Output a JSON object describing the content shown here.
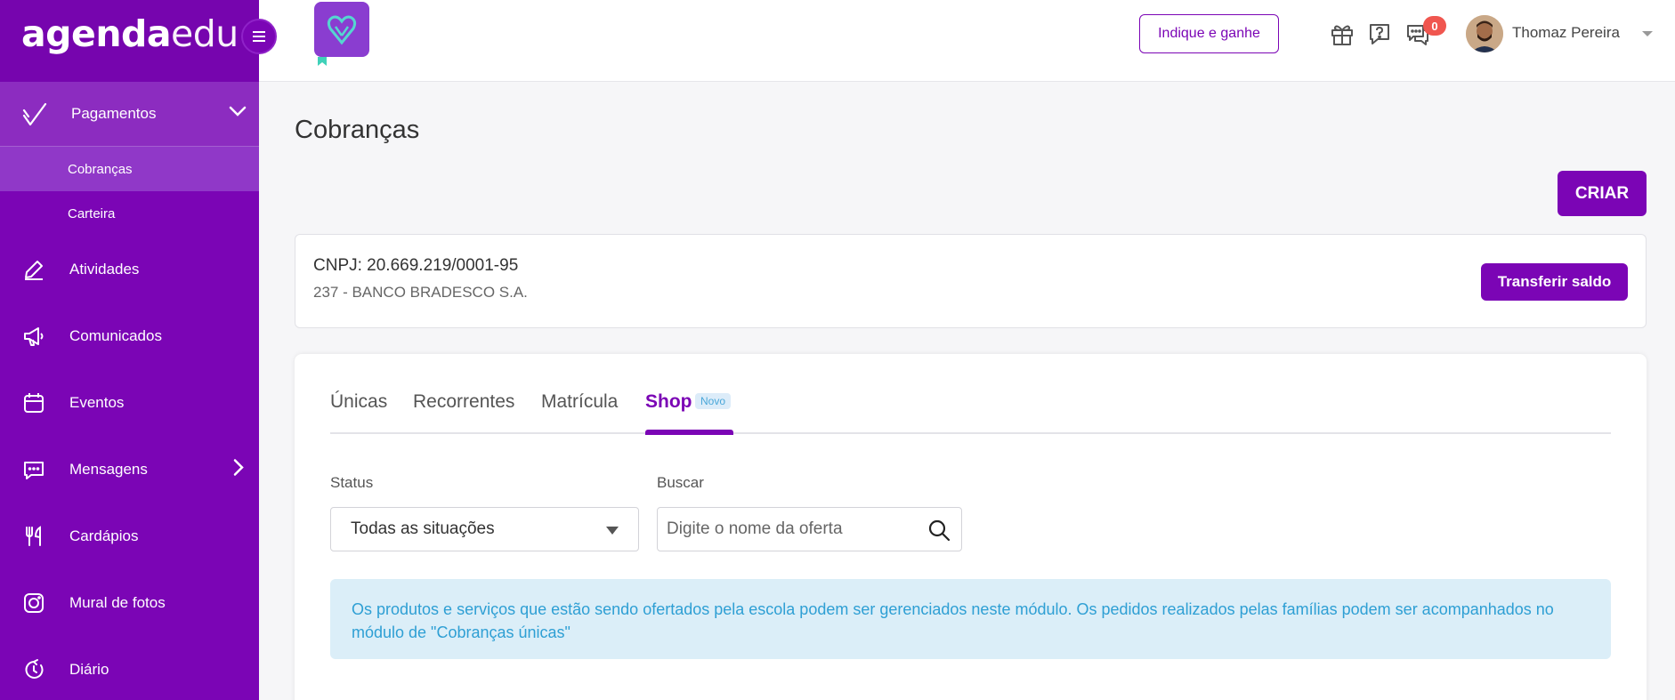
{
  "brand": {
    "part1": "agenda",
    "part2": "edu"
  },
  "sidebar": {
    "parent": {
      "label": "Pagamentos"
    },
    "sub_items": [
      {
        "label": "Cobranças"
      },
      {
        "label": "Carteira"
      }
    ],
    "items": [
      {
        "label": "Atividades",
        "icon": "pencil-icon"
      },
      {
        "label": "Comunicados",
        "icon": "megaphone-icon"
      },
      {
        "label": "Eventos",
        "icon": "calendar-icon"
      },
      {
        "label": "Mensagens",
        "icon": "chat-icon"
      },
      {
        "label": "Cardápios",
        "icon": "utensils-icon"
      },
      {
        "label": "Mural de fotos",
        "icon": "camera-icon"
      },
      {
        "label": "Diário",
        "icon": "clock-icon"
      }
    ]
  },
  "topbar": {
    "indique_label": "Indique e ganhe",
    "notifications_count": "0",
    "user_name": "Thomaz Pereira"
  },
  "page": {
    "title": "Cobranças",
    "criar_label": "CRIAR"
  },
  "account": {
    "cnpj": "CNPJ: 20.669.219/0001-95",
    "bank": "237 - BANCO BRADESCO S.A.",
    "transfer_label": "Transferir saldo"
  },
  "tabs": [
    {
      "label": "Únicas"
    },
    {
      "label": "Recorrentes"
    },
    {
      "label": "Matrícula"
    },
    {
      "label": "Shop",
      "badge": "Novo"
    }
  ],
  "filters": {
    "status_label": "Status",
    "status_value": "Todas as situações",
    "search_label": "Buscar",
    "search_placeholder": "Digite o nome da oferta"
  },
  "info_message": "Os produtos e serviços que estão sendo ofertados pela escola podem ser gerenciados neste módulo. Os pedidos realizados pelas famílias podem ser acompanhados no módulo de \"Cobranças únicas\"",
  "colors": {
    "primary": "#7b05b5",
    "info_bg": "#dbeef8",
    "info_text": "#2e9fd4",
    "badge": "#f0564f"
  }
}
